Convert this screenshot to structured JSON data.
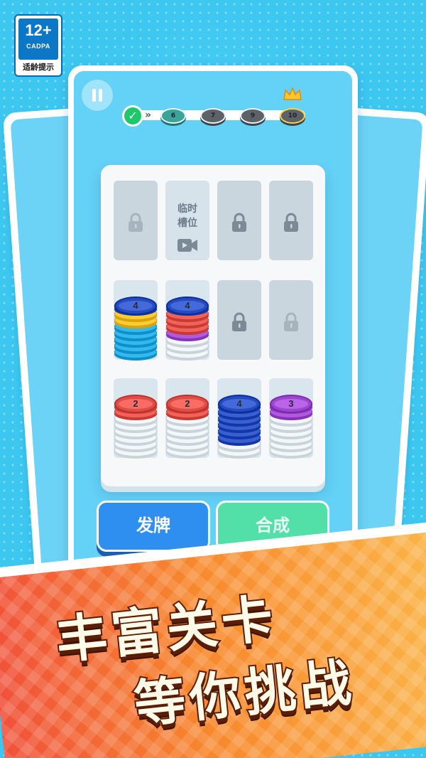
{
  "age_rating": {
    "age": "12+",
    "org": "CADPA",
    "hint": "适龄提示"
  },
  "level_progress": {
    "arrow": "»",
    "levels": [
      {
        "number": "6",
        "state": "current"
      },
      {
        "number": "7",
        "state": "upcoming"
      },
      {
        "number": "9",
        "state": "upcoming"
      },
      {
        "number": "10",
        "state": "boss"
      }
    ],
    "check_symbol": "✓"
  },
  "board": {
    "temp_slot_label": "临时\n槽位",
    "stacks": [
      {
        "slot": 4,
        "label": "4",
        "top_color": "#3a5fd0",
        "colors": [
          "#35b8f0",
          "#35b8f0",
          "#35b8f0",
          "#35b8f0",
          "#35b8f0",
          "#ffcc33",
          "#ffcc33",
          "#3a5fd0"
        ]
      },
      {
        "slot": 5,
        "label": "4",
        "top_color": "#3a5fd0",
        "colors": [
          "#ffffff",
          "#ffffff",
          "#ffffff",
          "#b05ae0",
          "#f0625a",
          "#f0625a",
          "#f0625a",
          "#3a5fd0"
        ]
      },
      {
        "slot": 8,
        "label": "2",
        "top_color": "#f0625a",
        "colors": [
          "#ffffff",
          "#ffffff",
          "#ffffff",
          "#ffffff",
          "#ffffff",
          "#ffffff",
          "#f0625a",
          "#f0625a"
        ]
      },
      {
        "slot": 9,
        "label": "2",
        "top_color": "#f0625a",
        "colors": [
          "#ffffff",
          "#ffffff",
          "#ffffff",
          "#ffffff",
          "#ffffff",
          "#ffffff",
          "#f0625a",
          "#f0625a"
        ]
      },
      {
        "slot": 10,
        "label": "4",
        "top_color": "#3a5fd0",
        "colors": [
          "#ffffff",
          "#ffffff",
          "#3a5fd0",
          "#3a5fd0",
          "#3a5fd0",
          "#3a5fd0",
          "#3a5fd0",
          "#3a5fd0"
        ]
      },
      {
        "slot": 11,
        "label": "3",
        "top_color": "#b05ae0",
        "colors": [
          "#ffffff",
          "#ffffff",
          "#ffffff",
          "#ffffff",
          "#ffffff",
          "#ffffff",
          "#b05ae0",
          "#b05ae0"
        ]
      }
    ]
  },
  "buttons": {
    "deal": "发牌",
    "merge": "合成"
  },
  "slogan": {
    "line1": "丰富关卡",
    "line2": "等你挑战"
  }
}
